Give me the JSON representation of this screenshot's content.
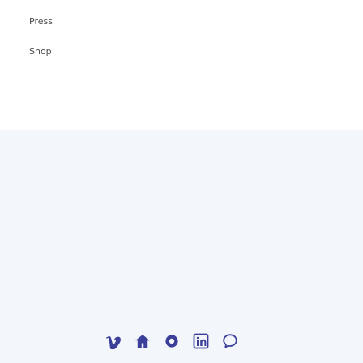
{
  "footer": {
    "links": {
      "press": "Press",
      "shop": "Shop"
    }
  },
  "social": {
    "icons": [
      "vimeo-icon",
      "home-icon",
      "flickr-icon",
      "linkedin-icon",
      "chat-icon"
    ],
    "icon_color": "#3b3f9a"
  },
  "colors": {
    "background_top": "#ffffff",
    "background_band": "#f3f7fb",
    "text_link": "#4a4a4a"
  }
}
